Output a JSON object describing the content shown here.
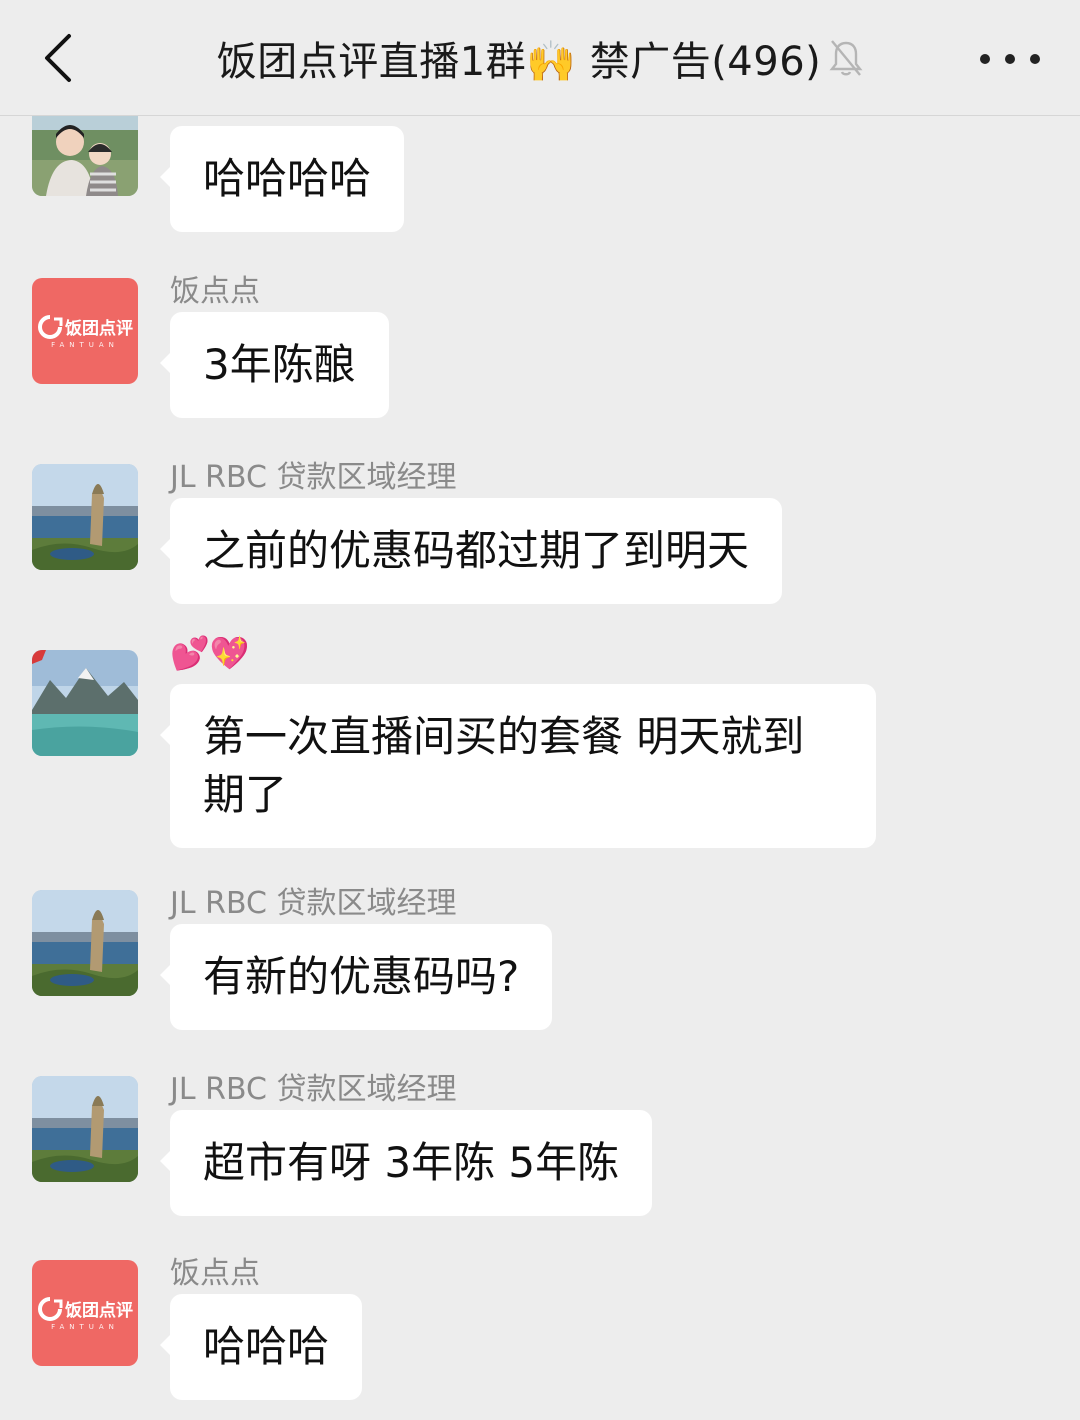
{
  "header": {
    "title": "饭团点评直播1群🙌 禁广告(496)",
    "back_icon": "chevron-left-icon",
    "mute_icon": "bell-slash-icon",
    "more_icon": "more-dots-icon"
  },
  "brand": {
    "name": "饭团点评",
    "sub": "FANTUAN",
    "color": "#ef6864"
  },
  "messages": [
    {
      "sender": "",
      "avatar": "photo-avatar-family",
      "text": "哈哈哈哈"
    },
    {
      "sender": "饭点点",
      "avatar": "fantuan-logo-avatar",
      "text": "3年陈酿"
    },
    {
      "sender": "JL RBC 贷款区域经理",
      "avatar": "photo-avatar-lake-tree",
      "text": "之前的优惠码都过期了到明天"
    },
    {
      "sender": "💕💖",
      "avatar": "photo-avatar-mountain-lake",
      "text": "第一次直播间买的套餐 明天就到期了"
    },
    {
      "sender": "JL RBC 贷款区域经理",
      "avatar": "photo-avatar-lake-tree",
      "text": "有新的优惠码吗?"
    },
    {
      "sender": "JL RBC 贷款区域经理",
      "avatar": "photo-avatar-lake-tree",
      "text": "超市有呀 3年陈 5年陈"
    },
    {
      "sender": "饭点点",
      "avatar": "fantuan-logo-avatar",
      "text": "哈哈哈"
    }
  ]
}
